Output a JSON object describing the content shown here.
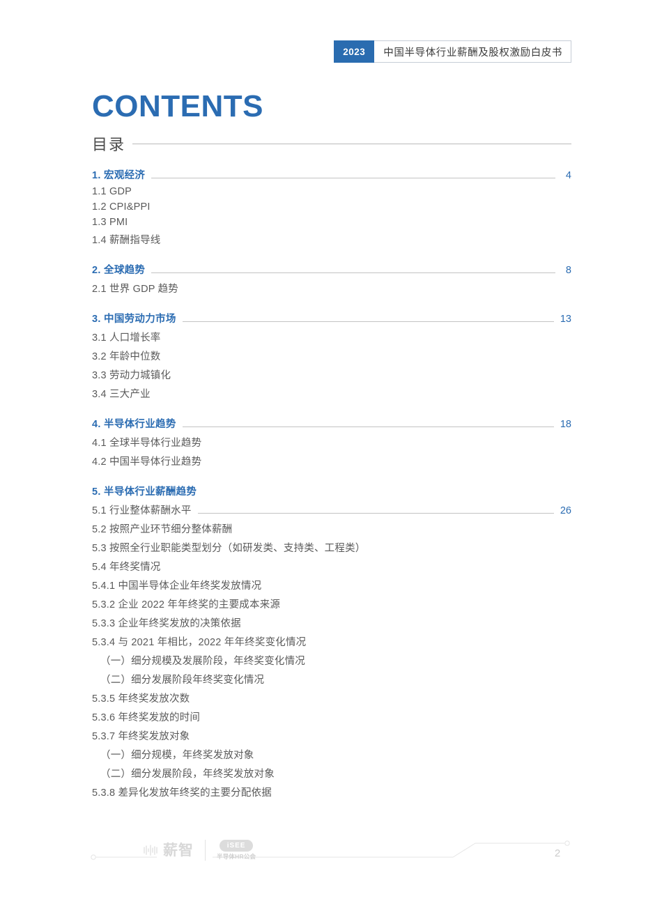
{
  "header": {
    "year": "2023",
    "title": "中国半导体行业薪酬及股权激励白皮书",
    "accent_color": "#2a6cb0"
  },
  "title_block": {
    "contents_en": "CONTENTS",
    "contents_cn": "目录",
    "accent_color": "#2b6cb2"
  },
  "toc": {
    "sections": [
      {
        "heading": {
          "label": "1. 宏观经济",
          "page": "4",
          "leader": true
        },
        "items": [
          {
            "label": "1.1 GDP",
            "page": "",
            "leader": false,
            "level": 2
          },
          {
            "label": "1.2 CPI&PPI",
            "page": "",
            "leader": false,
            "level": 2
          },
          {
            "label": "1.3 PMI",
            "page": "",
            "leader": false,
            "level": 2
          },
          {
            "label": "1.4 薪酬指导线",
            "page": "",
            "leader": false,
            "level": 2
          }
        ]
      },
      {
        "heading": {
          "label": "2. 全球趋势",
          "page": "8",
          "leader": true
        },
        "items": [
          {
            "label": "2.1 世界 GDP 趋势",
            "page": "",
            "leader": false,
            "level": 2
          }
        ]
      },
      {
        "heading": {
          "label": "3. 中国劳动力市场",
          "page": "13",
          "leader": true
        },
        "items": [
          {
            "label": "3.1 人口增长率",
            "page": "",
            "leader": false,
            "level": 2
          },
          {
            "label": "3.2 年龄中位数",
            "page": "",
            "leader": false,
            "level": 2
          },
          {
            "label": "3.3 劳动力城镇化",
            "page": "",
            "leader": false,
            "level": 2
          },
          {
            "label": "3.4 三大产业",
            "page": "",
            "leader": false,
            "level": 2
          }
        ]
      },
      {
        "heading": {
          "label": "4. 半导体行业趋势",
          "page": "18",
          "leader": true
        },
        "items": [
          {
            "label": "4.1 全球半导体行业趋势",
            "page": "",
            "leader": false,
            "level": 2
          },
          {
            "label": "4.2 中国半导体行业趋势",
            "page": "",
            "leader": false,
            "level": 2
          }
        ]
      },
      {
        "heading": {
          "label": "5. 半导体行业薪酬趋势",
          "page": "",
          "leader": false
        },
        "items": [
          {
            "label": "5.1 行业整体薪酬水平",
            "page": "26",
            "leader": true,
            "level": 2
          },
          {
            "label": "5.2 按照产业环节细分整体薪酬",
            "page": "",
            "leader": false,
            "level": 2
          },
          {
            "label": "5.3 按照全行业职能类型划分（如研发类、支持类、工程类）",
            "page": "",
            "leader": false,
            "level": 2
          },
          {
            "label": "5.4 年终奖情况",
            "page": "",
            "leader": false,
            "level": 2
          },
          {
            "label": "5.4.1 中国半导体企业年终奖发放情况",
            "page": "",
            "leader": false,
            "level": 2
          },
          {
            "label": "5.3.2 企业 2022 年年终奖的主要成本来源",
            "page": "",
            "leader": false,
            "level": 2
          },
          {
            "label": "5.3.3 企业年终奖发放的决策依据",
            "page": "",
            "leader": false,
            "level": 2
          },
          {
            "label": "5.3.4 与 2021 年相比，2022 年年终奖变化情况",
            "page": "",
            "leader": false,
            "level": 2
          },
          {
            "label": "（一）细分规模及发展阶段，年终奖变化情况",
            "page": "",
            "leader": false,
            "level": 3
          },
          {
            "label": "（二）细分发展阶段年终奖变化情况",
            "page": "",
            "leader": false,
            "level": 3
          },
          {
            "label": "5.3.5 年终奖发放次数",
            "page": "",
            "leader": false,
            "level": 2
          },
          {
            "label": "5.3.6 年终奖发放的时间",
            "page": "",
            "leader": false,
            "level": 2
          },
          {
            "label": "5.3.7 年终奖发放对象",
            "page": "",
            "leader": false,
            "level": 2
          },
          {
            "label": "（一）细分规模，年终奖发放对象",
            "page": "",
            "leader": false,
            "level": 3
          },
          {
            "label": "（二）细分发展阶段，年终奖发放对象",
            "page": "",
            "leader": false,
            "level": 3
          },
          {
            "label": "5.3.8 差异化发放年终奖的主要分配依据",
            "page": "",
            "leader": false,
            "level": 2
          }
        ]
      }
    ]
  },
  "footer": {
    "logo_primary_text": "薪智",
    "logo_secondary_badge": "iSEE",
    "logo_secondary_sub": "半导体HR公会",
    "page_number": "2"
  }
}
